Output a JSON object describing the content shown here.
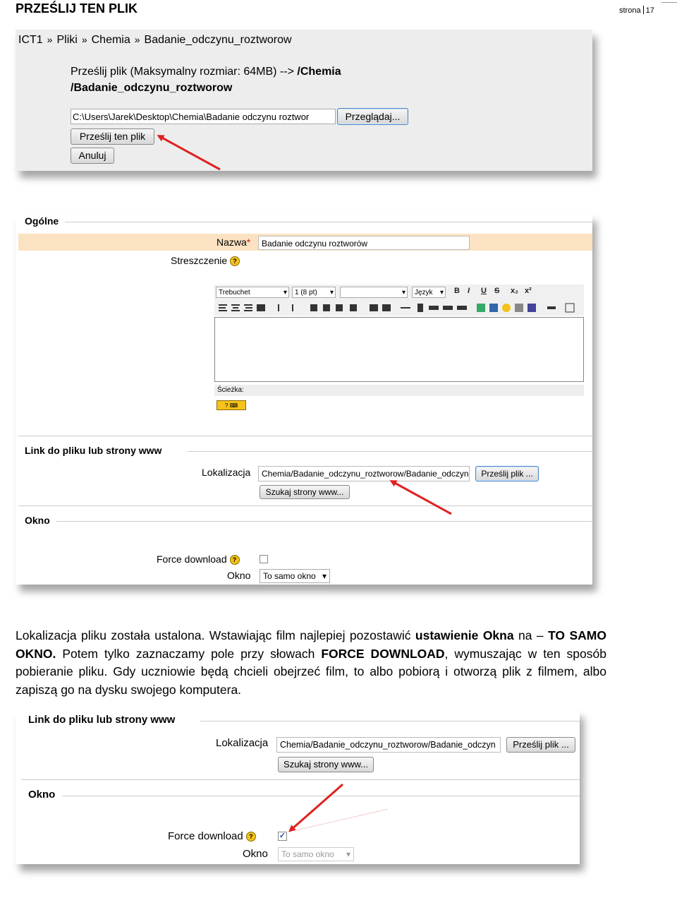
{
  "header": {
    "title": "PRZEŚLIJ TEN PLIK",
    "page_label": "strona",
    "page_number": "17"
  },
  "shot1": {
    "breadcrumb": [
      "ICT1",
      "Pliki",
      "Chemia",
      "Badanie_odczynu_roztworow"
    ],
    "breadcrumb_sep": "»",
    "upload_text": "Prześlij plik (Maksymalny rozmiar: 64MB) -->",
    "upload_path_1": "/Chemia",
    "upload_path_2": "/Badanie_odczynu_roztworow",
    "file_value": "C:\\Users\\Jarek\\Desktop\\Chemia\\Badanie odczynu roztwor",
    "browse_button": "Przeglądaj...",
    "upload_button": "Prześlij ten plik",
    "cancel_button": "Anuluj"
  },
  "shot2": {
    "general_legend": "Ogólne",
    "name_label": "Nazwa",
    "required_mark": "*",
    "name_value": "Badanie odczynu roztworów",
    "summary_label": "Streszczenie",
    "help_glyph": "?",
    "editor": {
      "font": "Trebuchet",
      "size": "1 (8 pt)",
      "format": "",
      "lang": "Język",
      "tb1": [
        "B",
        "I",
        "U",
        "S",
        "x₂",
        "x²"
      ],
      "path_label": "Ścieżka:"
    },
    "link_legend": "Link do pliku lub strony www",
    "location_label": "Lokalizacja",
    "location_value": "Chemia/Badanie_odczynu_roztworow/Badanie_odczyn",
    "upload_file_button": "Prześlij plik ...",
    "search_button": "Szukaj strony www...",
    "window_legend": "Okno",
    "force_label": "Force download",
    "window_label": "Okno",
    "window_value": "To samo okno"
  },
  "paragraph": {
    "p1": "Lokalizacja pliku została ustalona. Wstawiając film najlepiej pozostawić ",
    "b1": "ustawienie Okna",
    "p2": " na – ",
    "b2": "TO SAMO OKNO.",
    "p3": " Potem tylko zaznaczamy pole przy słowach ",
    "b3": "FORCE DOWNLOAD",
    "p4": ", wymuszając w ten sposób pobieranie pliku. Gdy uczniowie będą chcieli obejrzeć film, to albo pobiorą i otworzą plik z filmem, albo zapiszą go na dysku swojego komputera."
  },
  "shot3": {
    "link_legend": "Link do pliku lub strony www",
    "location_label": "Lokalizacja",
    "location_value": "Chemia/Badanie_odczynu_roztworow/Badanie_odczyn",
    "upload_file_button": "Prześlij plik ...",
    "search_button": "Szukaj strony www...",
    "window_legend": "Okno",
    "force_label": "Force download",
    "force_checked": true,
    "check_glyph": "✓",
    "window_label": "Okno",
    "window_value": "To samo okno"
  },
  "colors": {
    "arrow": "#e02020",
    "required_bg": "#fbe2c2",
    "button_border": "#4a88c6"
  }
}
